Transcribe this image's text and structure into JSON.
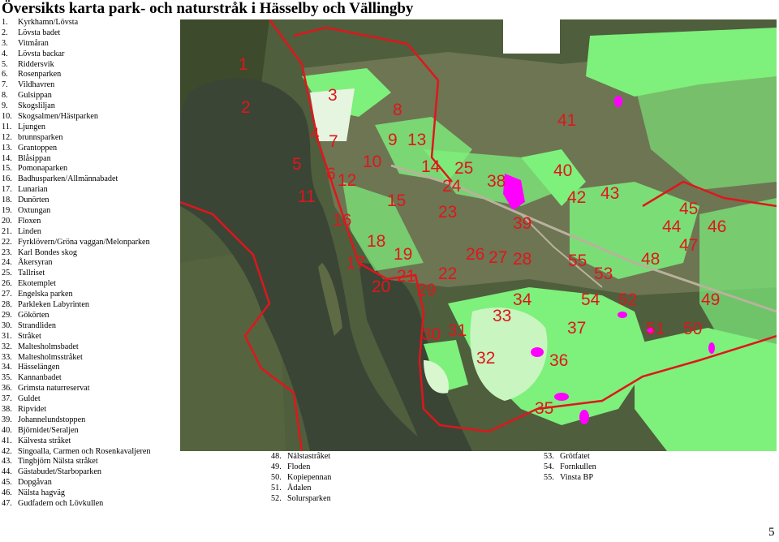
{
  "title": "Översikts karta park- och naturstråk i Hässelby och Vällingby",
  "legend": [
    {
      "num": "1.",
      "name": "Kyrkhamn/Lövsta"
    },
    {
      "num": "2.",
      "name": "Lövsta badet"
    },
    {
      "num": "3.",
      "name": "Vitmåran"
    },
    {
      "num": "4.",
      "name": "Lövsta backar"
    },
    {
      "num": "5.",
      "name": "Riddersvik"
    },
    {
      "num": "6.",
      "name": "Rosenparken"
    },
    {
      "num": "7.",
      "name": "Vildhavren"
    },
    {
      "num": "8.",
      "name": "Gulsippan"
    },
    {
      "num": "9.",
      "name": "Skogsliljan"
    },
    {
      "num": "10.",
      "name": "Skogsalmen/Hästparken"
    },
    {
      "num": "11.",
      "name": "Ljungen"
    },
    {
      "num": "12.",
      "name": "brunnsparken"
    },
    {
      "num": "13.",
      "name": "Grantoppen"
    },
    {
      "num": "14.",
      "name": "Blåsippan"
    },
    {
      "num": "15.",
      "name": "Pomonaparken"
    },
    {
      "num": "16.",
      "name": "Badhusparken/Allmännabadet"
    },
    {
      "num": "17.",
      "name": "Lunarian"
    },
    {
      "num": "18.",
      "name": "Dunörten"
    },
    {
      "num": "19.",
      "name": "Oxtungan"
    },
    {
      "num": "20.",
      "name": "Floxen"
    },
    {
      "num": "21.",
      "name": "Linden"
    },
    {
      "num": "22.",
      "name": "Fyrklövern/Gröna vaggan/Melonparken"
    },
    {
      "num": "23.",
      "name": "Karl Bondes skog"
    },
    {
      "num": "24.",
      "name": "Åkersyran"
    },
    {
      "num": "25.",
      "name": "Tallriset"
    },
    {
      "num": "26.",
      "name": "Ekotemplet"
    },
    {
      "num": "27.",
      "name": "Engelska parken"
    },
    {
      "num": "28.",
      "name": "Parkleken Labyrinten"
    },
    {
      "num": "29.",
      "name": "Gökörten"
    },
    {
      "num": "30.",
      "name": "Strandliden"
    },
    {
      "num": "31.",
      "name": "Stråket"
    },
    {
      "num": "32.",
      "name": "Maltesholmsbadet"
    },
    {
      "num": "33.",
      "name": "Maltesholmsstråket"
    },
    {
      "num": "34.",
      "name": "Hässelängen"
    },
    {
      "num": "35.",
      "name": "Kannanbadet"
    },
    {
      "num": "36.",
      "name": "Grimsta naturreservat"
    },
    {
      "num": "37.",
      "name": "Guldet"
    },
    {
      "num": "38.",
      "name": "Ripvidet"
    },
    {
      "num": "39.",
      "name": "Johannelundstoppen"
    },
    {
      "num": "40.",
      "name": "Björnidet/Seraljen"
    },
    {
      "num": "41.",
      "name": "Kälvesta stråket"
    },
    {
      "num": "42.",
      "name": "Singoalla, Carmen och Rosenkavaljeren"
    },
    {
      "num": "43.",
      "name": "Tingbjörn Nälsta stråket"
    },
    {
      "num": "44.",
      "name": "Gästabudet/Starboparken"
    },
    {
      "num": "45.",
      "name": "Dopgåvan"
    },
    {
      "num": "46.",
      "name": "Nälsta hagväg"
    },
    {
      "num": "47.",
      "name": "Gudfadern och Lövkullen"
    },
    {
      "num": "48.",
      "name": "Nälstastråket"
    },
    {
      "num": "49.",
      "name": "Floden"
    },
    {
      "num": "50.",
      "name": "Kopiepennan"
    },
    {
      "num": "51.",
      "name": "Ådalen"
    },
    {
      "num": "52.",
      "name": "Solursparken"
    },
    {
      "num": "53.",
      "name": "Grötfatet"
    },
    {
      "num": "54.",
      "name": "Fornkullen"
    },
    {
      "num": "55.",
      "name": "Vinsta BP"
    }
  ],
  "map_labels": [
    "1",
    "2",
    "3",
    "4",
    "5",
    "6",
    "7",
    "8",
    "9",
    "13",
    "10",
    "11",
    "12",
    "14",
    "15",
    "16",
    "17",
    "18",
    "19",
    "20",
    "21",
    "22",
    "23",
    "24",
    "25",
    "26",
    "27",
    "28",
    "29",
    "30",
    "31",
    "32",
    "33",
    "34",
    "35",
    "36",
    "37",
    "38",
    "39",
    "40",
    "41",
    "42",
    "43",
    "44",
    "45",
    "46",
    "47",
    "48",
    "49",
    "50",
    "51",
    "52",
    "53",
    "54",
    "55"
  ],
  "colors": {
    "park_green": "#7ef07c",
    "boundary_red": "#e0161c",
    "water": "#3a4536",
    "highlight_magenta": "#ff00ff",
    "label_red": "#e0161c"
  },
  "page_number": "5"
}
